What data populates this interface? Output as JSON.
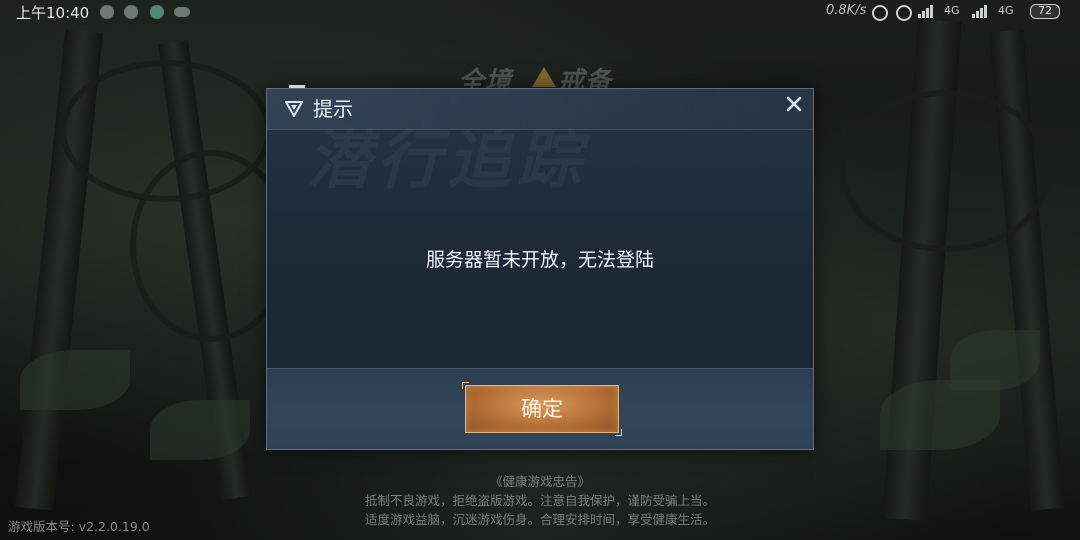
{
  "status_bar": {
    "time": "上午10:40",
    "network_speed": "0.8K/s",
    "net_type_1": "4G",
    "net_type_2": "4G",
    "battery": "72"
  },
  "game_logo": {
    "part1": "全境",
    "part2": "戒备"
  },
  "dialog": {
    "title": "提示",
    "message": "服务器暂未开放，无法登陆",
    "confirm_label": "确定",
    "watermark": "潜行追踪"
  },
  "health_advice": {
    "title": "《健康游戏忠告》",
    "line1": "抵制不良游戏，拒绝盗版游戏。注意自我保护，谨防受骗上当。",
    "line2": "适度游戏益脑，沉迷游戏伤身。合理安排时间，享受健康生活。"
  },
  "version": "游戏版本号: v2.2.0.19.0",
  "colors": {
    "dialog_bg": "#1e2a38",
    "button_accent": "#b56f36"
  }
}
